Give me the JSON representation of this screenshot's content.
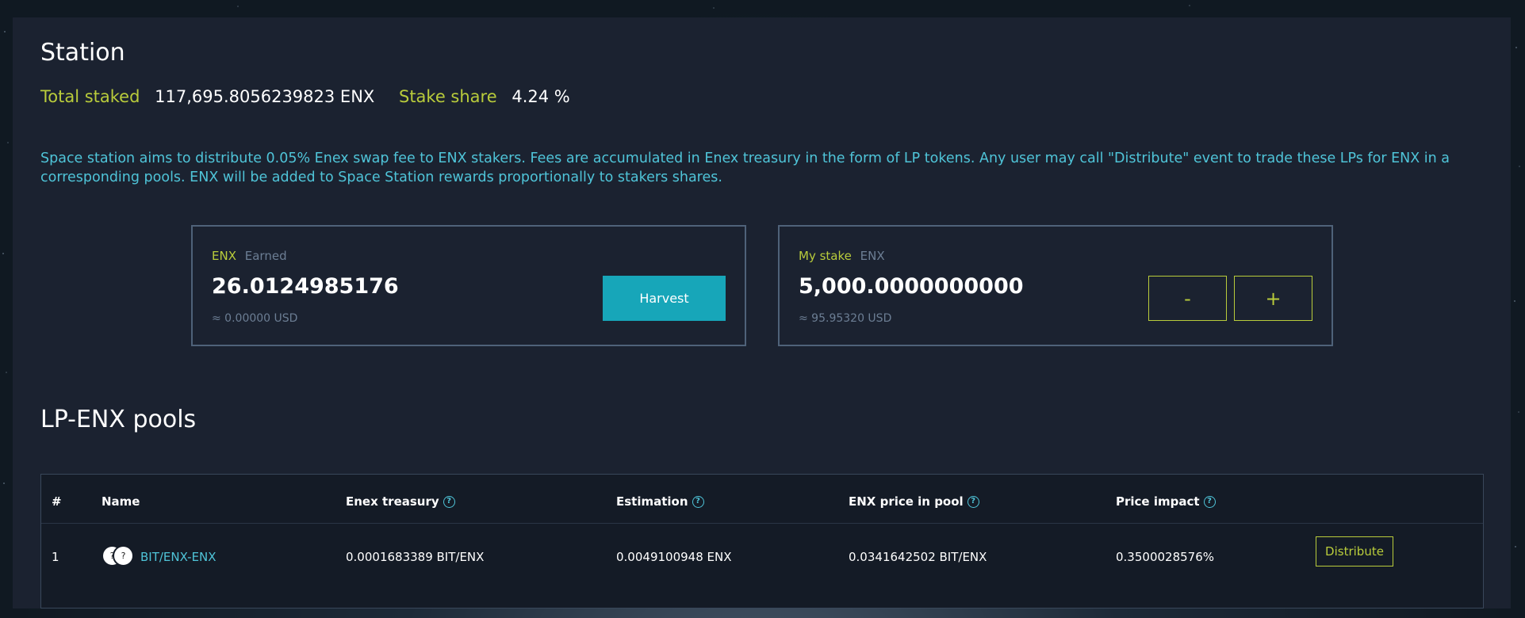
{
  "station": {
    "title": "Station",
    "total_staked_label": "Total staked",
    "total_staked_value": "117,695.8056239823 ENX",
    "stake_share_label": "Stake share",
    "stake_share_value": "4.24 %",
    "description": "Space station aims to distribute 0.05% Enex swap fee to ENX stakers. Fees are accumulated in Enex treasury in the form of LP tokens. Any user may call \"Distribute\" event to trade these LPs for ENX in a corresponding pools. ENX will be added to Space Station rewards proportionally to stakers shares."
  },
  "earned_card": {
    "token": "ENX",
    "label": "Earned",
    "amount": "26.0124985176",
    "usd": "≈ 0.00000 USD",
    "harvest_label": "Harvest"
  },
  "stake_card": {
    "label": "My stake",
    "token": "ENX",
    "amount": "5,000.0000000000",
    "usd": "≈ 95.95320 USD",
    "minus_label": "-",
    "plus_label": "+"
  },
  "pools": {
    "title": "LP-ENX pools",
    "columns": {
      "num": "#",
      "name": "Name",
      "treasury": "Enex treasury",
      "estimation": "Estimation",
      "price": "ENX price in pool",
      "impact": "Price impact"
    },
    "help_glyph": "?",
    "rows": [
      {
        "num": "1",
        "coin_glyph_1": "?",
        "coin_glyph_2": "?",
        "name": "BIT/ENX-ENX",
        "treasury": "0.0001683389 BIT/ENX",
        "estimation": "0.0049100948 ENX",
        "price": "0.0341642502 BIT/ENX",
        "impact": "0.3500028576%",
        "action_label": "Distribute"
      }
    ]
  },
  "colors": {
    "accent_yellow": "#b9cc3b",
    "accent_cyan": "#4fc4d8",
    "button_teal": "#17a6b9",
    "panel_bg": "#1b2230"
  }
}
